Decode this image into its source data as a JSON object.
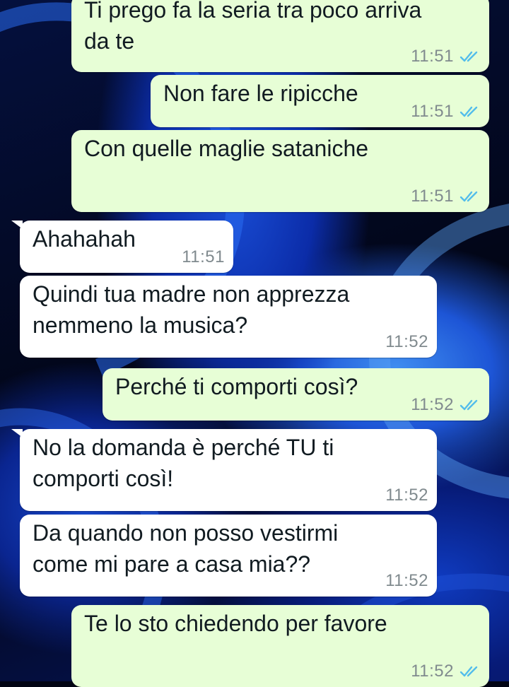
{
  "messages": [
    {
      "direction": "out",
      "text": "Ti prego fa la seria tra poco arriva\nda te",
      "time": "11:51",
      "status": "read-ticks-icon"
    },
    {
      "direction": "out",
      "text": "Non fare le ripicche",
      "time": "11:51",
      "status": "read-ticks-icon"
    },
    {
      "direction": "out",
      "text": "Con quelle maglie sataniche",
      "time": "11:51",
      "status": "read-ticks-icon"
    },
    {
      "direction": "in",
      "text": "Ahahahah",
      "time": "11:51"
    },
    {
      "direction": "in",
      "text": "Quindi tua madre non apprezza\nnemmeno la musica?",
      "time": "11:52"
    },
    {
      "direction": "out",
      "text": "Perché ti comporti così?",
      "time": "11:52",
      "status": "read-ticks-icon"
    },
    {
      "direction": "in",
      "text": "No la domanda è perché TU ti\ncomporti così!",
      "time": "11:52"
    },
    {
      "direction": "in",
      "text": "Da quando non posso vestirmi\ncome mi pare a casa mia??",
      "time": "11:52"
    },
    {
      "direction": "out",
      "text": "Te lo sto chiedendo per favore",
      "time": "11:52",
      "status": "read-ticks-icon"
    }
  ],
  "colors": {
    "outgoing_bubble": "#e7fed6",
    "incoming_bubble": "#ffffff",
    "read_ticks": "#53bdeb",
    "timestamp": "#808a8e"
  }
}
